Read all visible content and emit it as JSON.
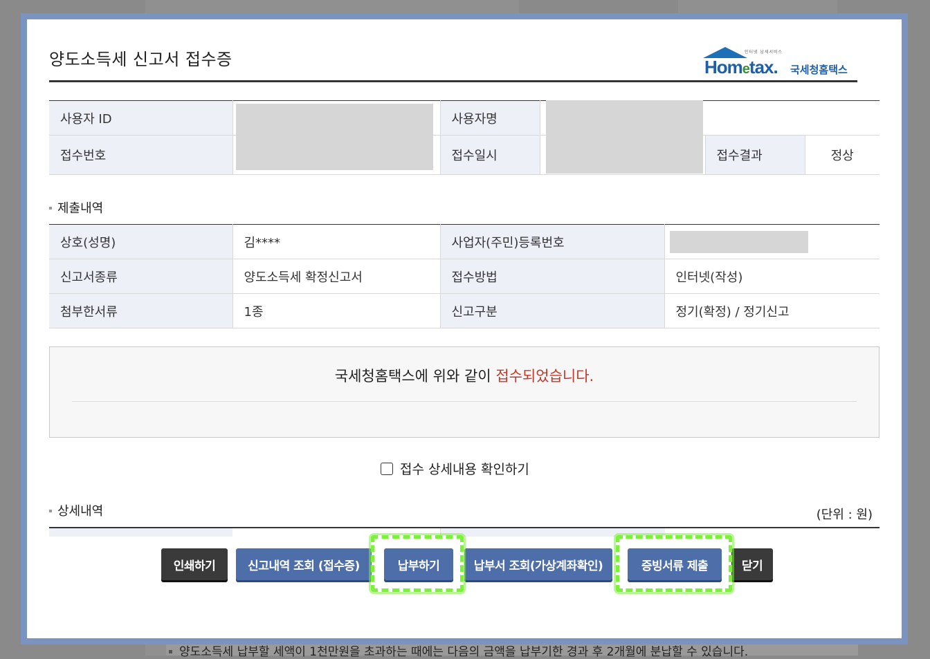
{
  "background": {
    "note": "양도소득세 납부할 세액이 1천만원을 초과하는 때에는 다음의 금액을 납부기한 경과 후 2개월에 분납할 수 있습니다."
  },
  "modal": {
    "title": "양도소득세 신고서 접수증",
    "logo": {
      "small_text": "인터넷 납세서비스",
      "brand_a": "Hom",
      "brand_e": "e",
      "brand_b": "tax.",
      "brand_kr": "국세청홈택스"
    },
    "receipt": {
      "user_id_label": "사용자 ID",
      "user_name_label": "사용자명",
      "receipt_no_label": "접수번호",
      "receipt_date_label": "접수일시",
      "result_label": "접수결과",
      "result_value": "정상"
    },
    "submission": {
      "section_title": "제출내역",
      "rows": [
        {
          "l1": "상호(성명)",
          "v1": "김****",
          "l2": "사업자(주민)등록번호",
          "v2": ""
        },
        {
          "l1": "신고서종류",
          "v1": "양도소득세 확정신고서",
          "l2": "접수방법",
          "v2": "인터넷(작성)"
        },
        {
          "l1": "첨부한서류",
          "v1": "1종",
          "l2": "신고구분",
          "v2": "정기(확정) / 정기신고"
        }
      ]
    },
    "notice": {
      "prefix": "국세청홈택스에 위와 같이 ",
      "highlight": "접수되었습니다."
    },
    "check_label": "접수 상세내용 확인하기",
    "detail": {
      "section_title": "상세내역",
      "unit": "(단위 : 원)"
    },
    "buttons": {
      "print": "인쇄하기",
      "history": "신고내역 조회 (접수증)",
      "pay": "납부하기",
      "bill": "납부서 조회(가상계좌확인)",
      "evidence": "증빙서류 제출",
      "close": "닫기"
    },
    "colors": {
      "frame": "#7b93c0",
      "button_dark": "#3a3a3a",
      "button_blue": "#4d6ea8",
      "highlight_green": "#7cf03a",
      "notice_red": "#c0392b"
    }
  }
}
